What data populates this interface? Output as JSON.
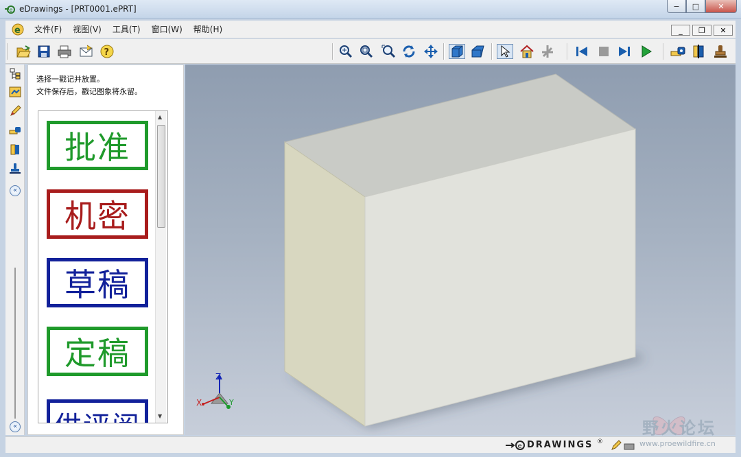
{
  "window": {
    "title": "eDrawings - [PRT0001.ePRT]",
    "controls": {
      "minimize": "−",
      "maximize": "□",
      "close": "✕"
    }
  },
  "menu": {
    "items": [
      "文件(F)",
      "视图(V)",
      "工具(T)",
      "窗口(W)",
      "帮助(H)"
    ],
    "mdi": {
      "minimize": "_",
      "restore": "❐",
      "close": "✕"
    }
  },
  "toolbar": {
    "left_icons": [
      "open-icon",
      "save-icon",
      "print-icon",
      "send-mail-icon",
      "help-icon"
    ],
    "view_icons": [
      "zoom-icon",
      "zoom-to-fit-icon",
      "zoom-area-icon",
      "rotate-icon",
      "pan-icon"
    ],
    "display_icons": [
      "shaded-icon",
      "perspective-icon"
    ],
    "select_icons": [
      "select-icon",
      "home-icon",
      "3d-pointer-icon"
    ],
    "animate_icons": [
      "first-frame-icon",
      "stop-icon",
      "next-frame-icon",
      "play-icon"
    ],
    "tool_icons": [
      "measure-icon",
      "section-icon",
      "stamp-icon"
    ]
  },
  "leftbar": {
    "icons": [
      "components-icon",
      "configurations-icon",
      "markup-icon",
      "measure-icon",
      "section-icon",
      "stamp-icon"
    ],
    "collapse_label": "«"
  },
  "panel": {
    "instruction_1": "选择一戳记并放置。",
    "instruction_2": "文件保存后，戳记图象将永留。",
    "stamps": [
      {
        "text": "批准",
        "color": "#1f9a2b"
      },
      {
        "text": "机密",
        "color": "#a81c1c"
      },
      {
        "text": "草稿",
        "color": "#12219a"
      },
      {
        "text": "定稿",
        "color": "#1f9a2b"
      },
      {
        "text": "供评阅",
        "color": "#12219a"
      }
    ],
    "scroll_up": "▲",
    "scroll_down": "▼"
  },
  "triad": {
    "x": "X",
    "y": "Y",
    "z": "Z"
  },
  "status": {
    "brand": "DRAWINGS",
    "registered": "®"
  },
  "watermark": {
    "text": "野火论坛",
    "url": "www.proewildfire.cn"
  },
  "colors": {
    "accent": "#1a5ea8",
    "viewport_top": "#8f9db0",
    "viewport_bottom": "#c7ceda"
  }
}
